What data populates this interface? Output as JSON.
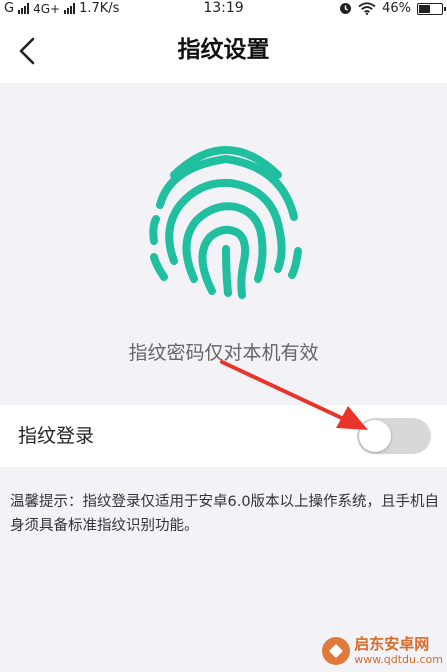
{
  "status_bar": {
    "carrier_signal": "G",
    "network": "4G+",
    "speed": "1.7K/s",
    "time": "13:19",
    "battery": "46%",
    "battery_level": 0.46
  },
  "nav": {
    "title": "指纹设置"
  },
  "hero": {
    "hint": "指纹密码仅对本机有效",
    "fingerprint_color": "#1fbf9f"
  },
  "setting": {
    "label": "指纹登录",
    "enabled": false
  },
  "tip": {
    "text": "温馨提示：指纹登录仅适用于安卓6.0版本以上操作系统，且手机自身须具备标准指纹识别功能。"
  },
  "annotation": {
    "arrow_color": "#e8352a"
  },
  "watermark": {
    "name": "启东安卓网",
    "url": "www.qdtdu.com"
  }
}
